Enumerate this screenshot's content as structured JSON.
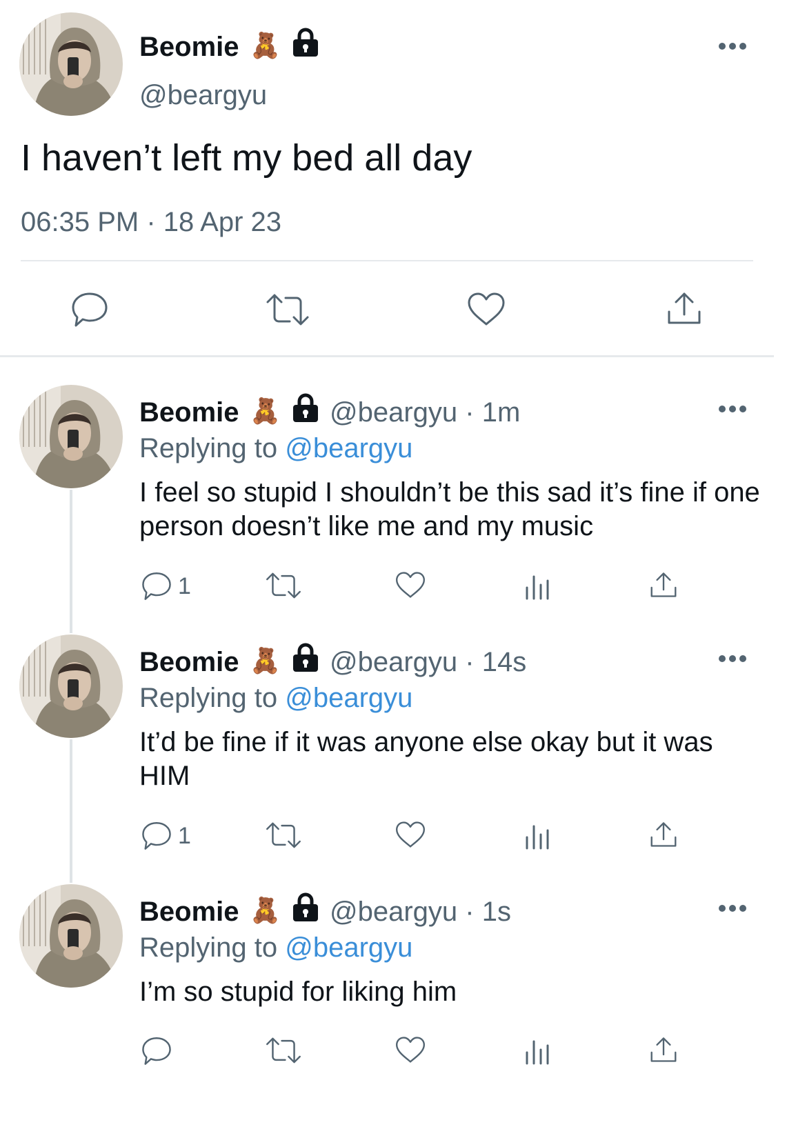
{
  "main_tweet": {
    "display_name": "Beomie",
    "badge_emoji": "🧸",
    "handle": "@beargyu",
    "text": "I haven’t left my bed all day",
    "timestamp": "06:35 PM · 18 Apr 23"
  },
  "replies": [
    {
      "display_name": "Beomie",
      "badge_emoji": "🧸",
      "handle_time": "@beargyu · 1m",
      "replying_prefix": "Replying to ",
      "replying_handle": "@beargyu",
      "text": "I feel so stupid I shouldn’t be this sad it’s fine if one person doesn’t like me and my music",
      "reply_count": "1"
    },
    {
      "display_name": "Beomie",
      "badge_emoji": "🧸",
      "handle_time": "@beargyu · 14s",
      "replying_prefix": "Replying to ",
      "replying_handle": "@beargyu",
      "text": "It’d be fine if it was anyone else okay but it was HIM",
      "reply_count": "1"
    },
    {
      "display_name": "Beomie",
      "badge_emoji": "🧸",
      "handle_time": "@beargyu · 1s",
      "replying_prefix": "Replying to ",
      "replying_handle": "@beargyu",
      "text": "I’m so stupid for liking him",
      "reply_count": ""
    }
  ],
  "colors": {
    "text": "#0f1419",
    "secondary": "#536471",
    "link": "#3a8ed8",
    "divider": "#e6e9ec"
  },
  "icons": [
    "reply-icon",
    "retweet-icon",
    "like-icon",
    "views-icon",
    "share-icon",
    "lock-icon",
    "more-icon"
  ]
}
